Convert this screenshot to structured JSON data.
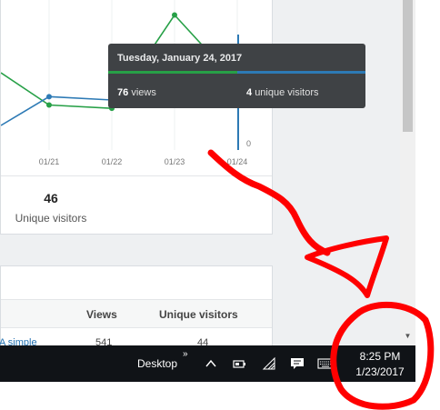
{
  "chart_data": {
    "type": "line",
    "x": [
      "01/21",
      "01/22",
      "01/23",
      "01/24"
    ],
    "series": [
      {
        "name": "Views",
        "color": "#27a047",
        "values": [
          27,
          25,
          81,
          40
        ]
      },
      {
        "name": "Unique visitors",
        "color": "#2d7ab5",
        "values": [
          32,
          30,
          36,
          34
        ]
      }
    ],
    "right_axis_ticks": [
      "0"
    ],
    "right_axis_partial_tick": "8"
  },
  "stats": {
    "value": "46",
    "label": "Unique visitors"
  },
  "tooltip": {
    "title": "Tuesday, January 24, 2017",
    "views_value": "76",
    "views_label": "views",
    "visitors_value": "4",
    "visitors_label": "unique visitors"
  },
  "table": {
    "columns": [
      "Views",
      "Unique visitors"
    ],
    "row": {
      "title": "A simple",
      "views": "541",
      "visitors": "44"
    }
  },
  "taskbar": {
    "desktop_label": "Desktop",
    "chevron": "»",
    "time": "8:25 PM",
    "date": "1/23/2017",
    "icons": [
      "chevron-up-icon",
      "battery-icon",
      "wifi-icon",
      "notification-icon",
      "keyboard-icon"
    ]
  },
  "colors": {
    "annotation": "#ff0000",
    "views": "#27a047",
    "visitors": "#2d7ab5"
  }
}
